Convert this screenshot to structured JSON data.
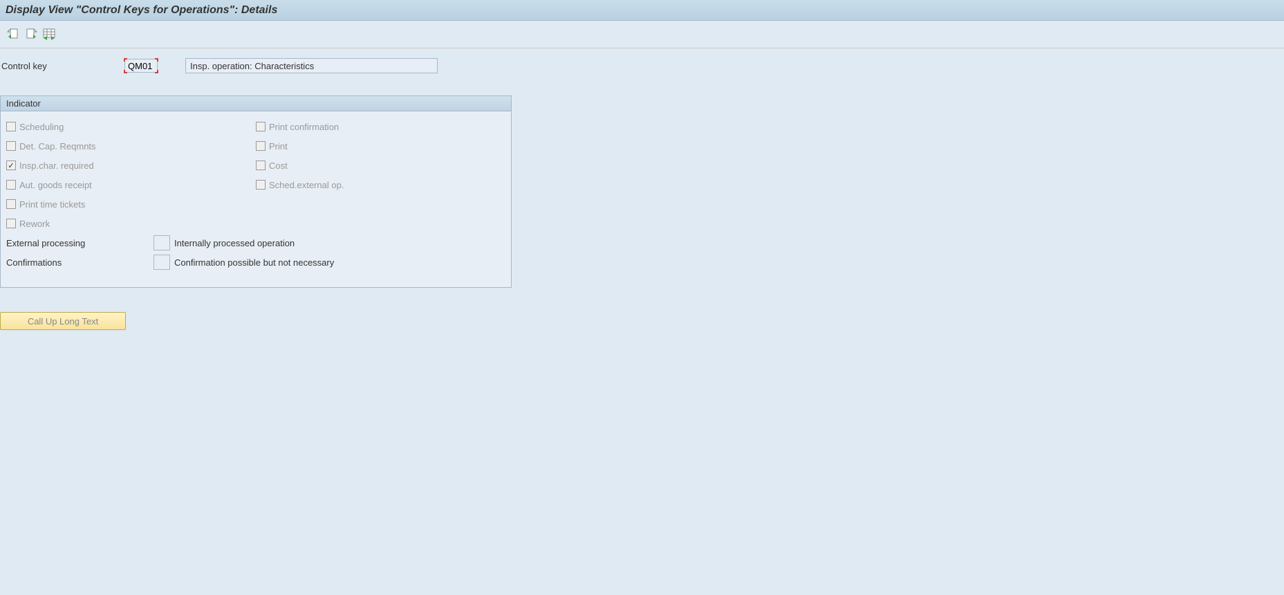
{
  "title": "Display View \"Control Keys for Operations\": Details",
  "toolbar": {
    "icons": [
      "doc-back-icon",
      "doc-forward-icon",
      "table-icon"
    ]
  },
  "header": {
    "control_key_label": "Control key",
    "control_key_value": "QM01",
    "description_value": "Insp. operation: Characteristics"
  },
  "panel": {
    "title": "Indicator",
    "left_checks": [
      {
        "label": "Scheduling",
        "checked": false
      },
      {
        "label": "Det. Cap. Reqmnts",
        "checked": false
      },
      {
        "label": "Insp.char. required",
        "checked": true
      },
      {
        "label": "Aut. goods receipt",
        "checked": false
      },
      {
        "label": "Print time tickets",
        "checked": false
      },
      {
        "label": "Rework",
        "checked": false
      }
    ],
    "right_checks": [
      {
        "label": "Print confirmation",
        "checked": false
      },
      {
        "label": "Print",
        "checked": false
      },
      {
        "label": "Cost",
        "checked": false
      },
      {
        "label": "Sched.external op.",
        "checked": false
      }
    ],
    "ext_proc_label": "External processing",
    "ext_proc_value": "",
    "ext_proc_text": "Internally processed operation",
    "confirm_label": "Confirmations",
    "confirm_value": "",
    "confirm_text": "Confirmation possible but not necessary"
  },
  "buttons": {
    "long_text": "Call Up Long Text"
  }
}
